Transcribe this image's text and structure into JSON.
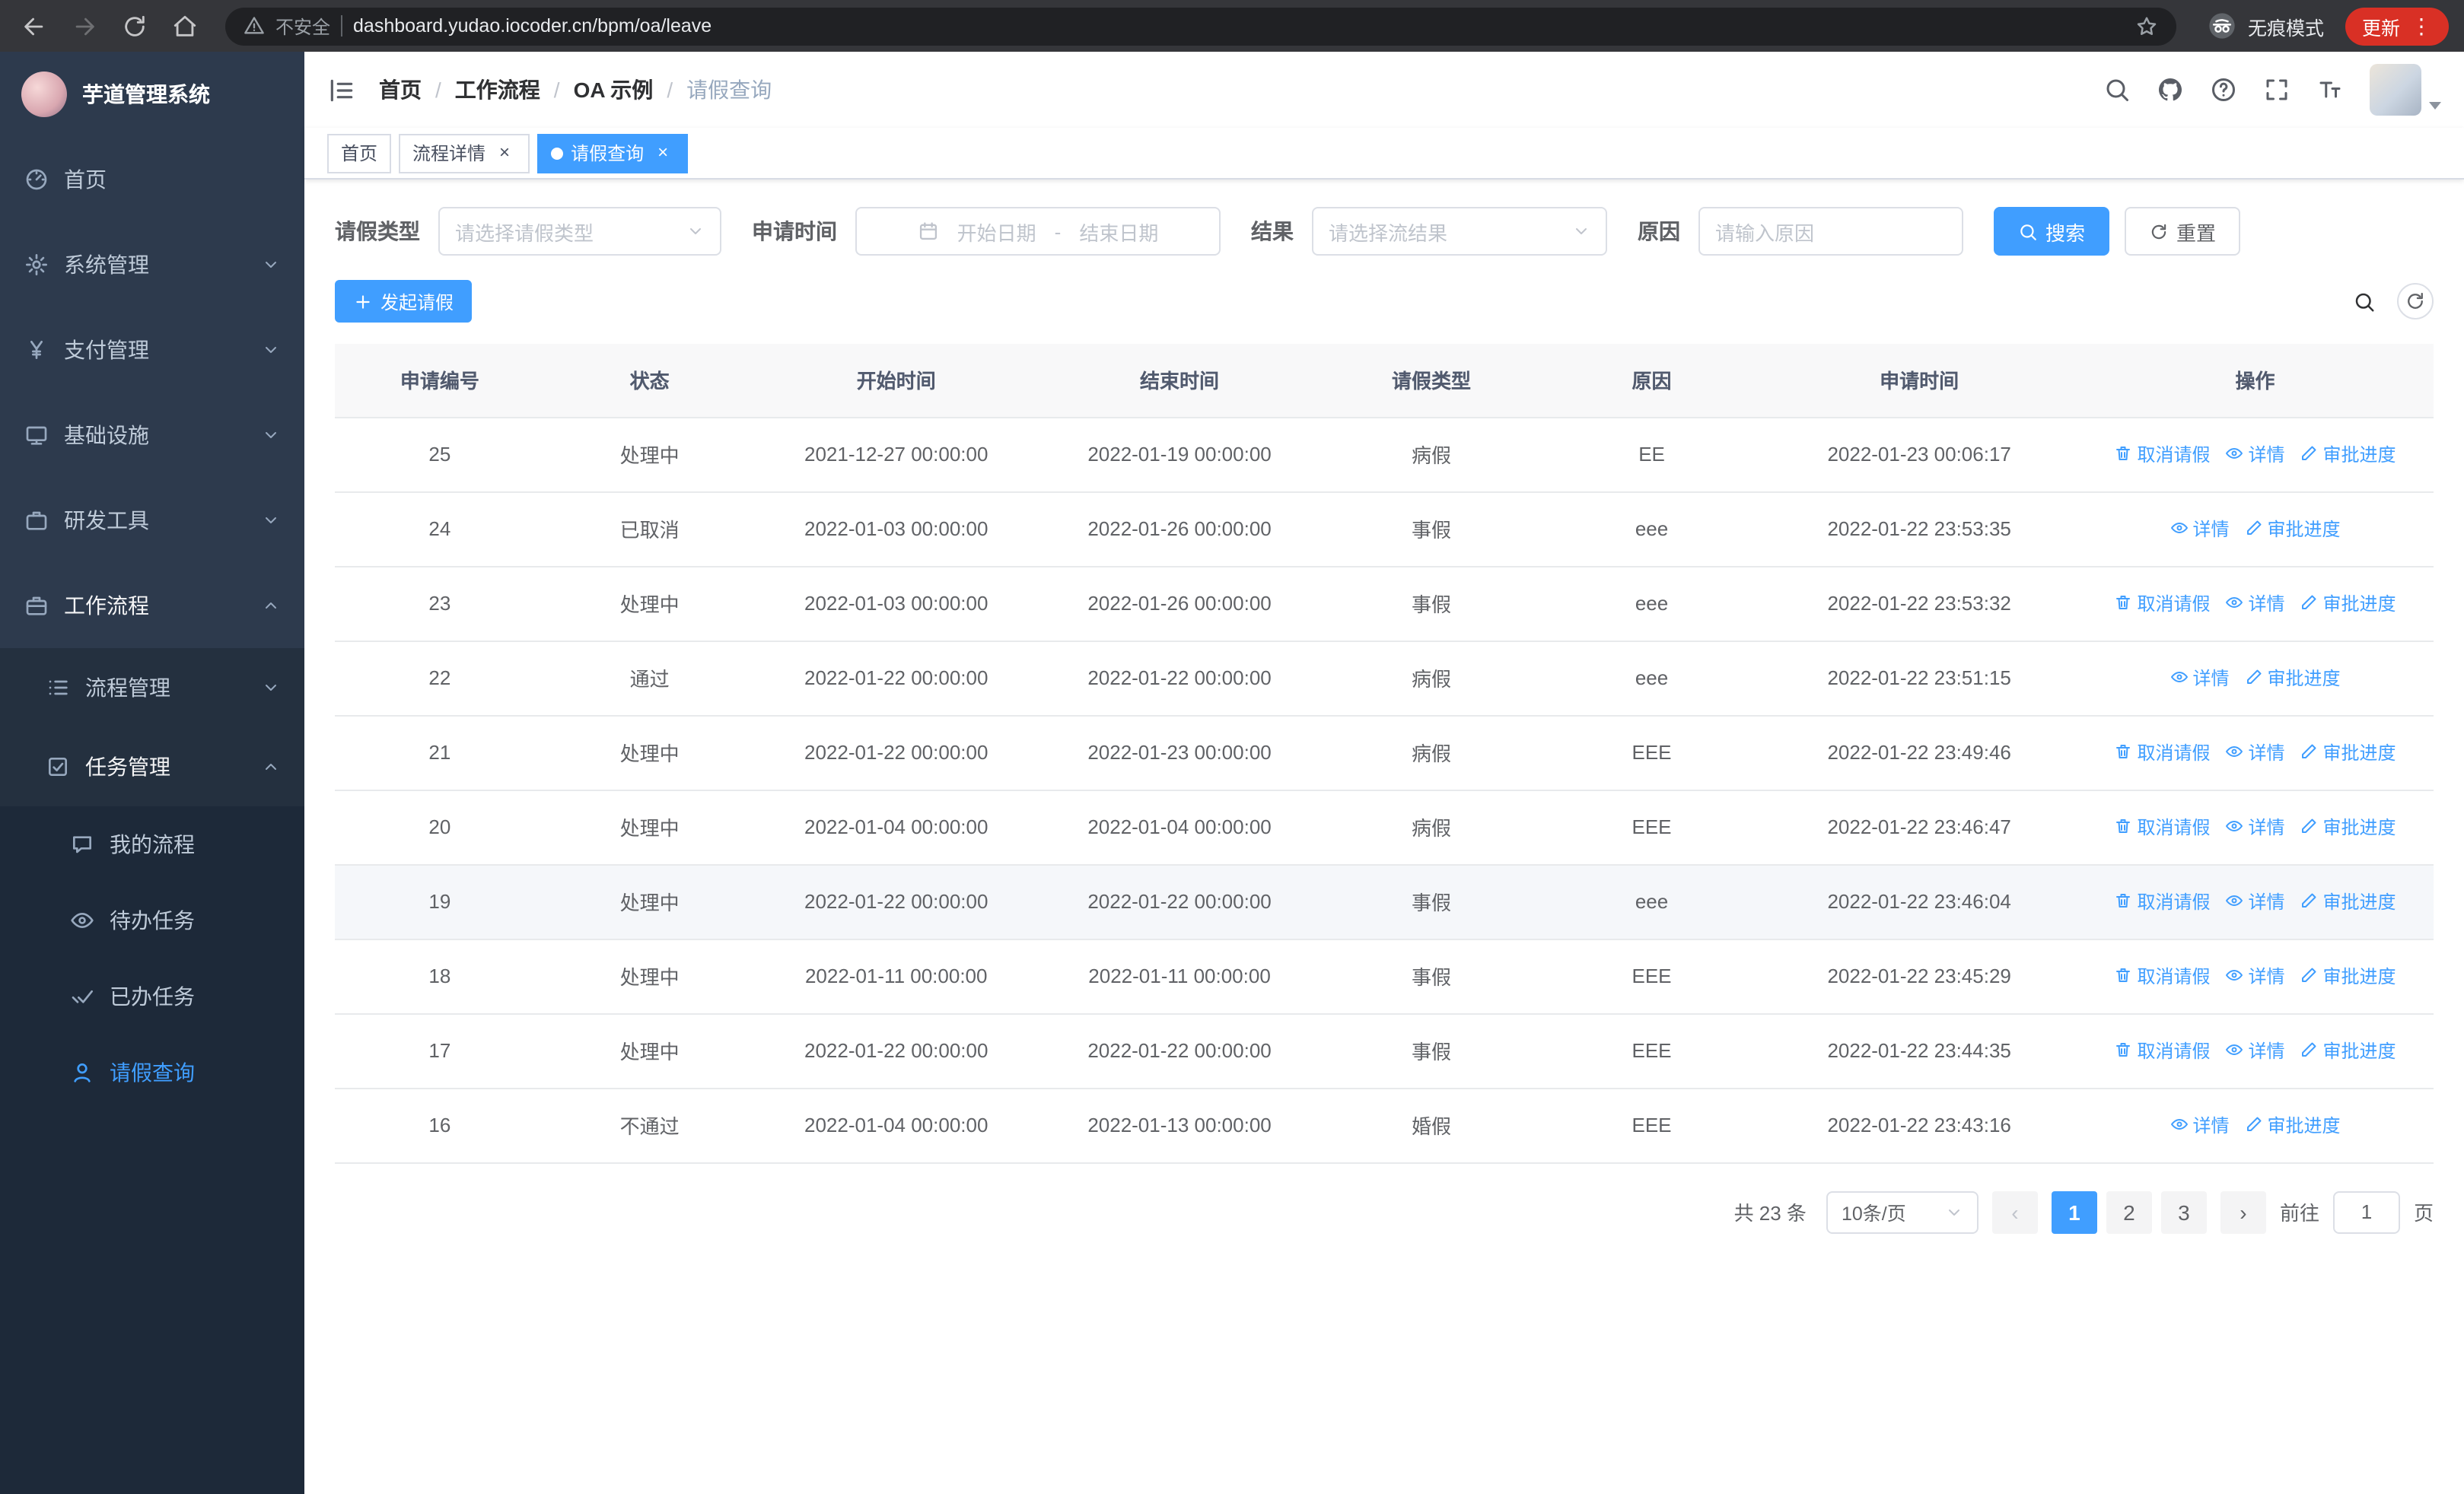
{
  "browser": {
    "security_warning": "不安全",
    "url": "dashboard.yudao.iocoder.cn/bpm/oa/leave",
    "incognito_label": "无痕模式",
    "update_label": "更新"
  },
  "icons": {
    "prev": "‹",
    "next": "›",
    "menu_dots": "⋮",
    "close": "×",
    "breadcrumb_sep": "/"
  },
  "sidebar": {
    "logo_title": "芋道管理系统",
    "items": [
      {
        "name": "home",
        "label": "首页",
        "icon": "dashboard-icon",
        "level": 1
      },
      {
        "name": "system",
        "label": "系统管理",
        "icon": "gear-icon",
        "level": 1,
        "arrow": "down"
      },
      {
        "name": "payment",
        "label": "支付管理",
        "icon": "yen-icon",
        "level": 1,
        "arrow": "down"
      },
      {
        "name": "infrastructure",
        "label": "基础设施",
        "icon": "monitor-icon",
        "level": 1,
        "arrow": "down"
      },
      {
        "name": "dev-tools",
        "label": "研发工具",
        "icon": "briefcase-icon",
        "level": 1,
        "arrow": "down"
      },
      {
        "name": "workflow",
        "label": "工作流程",
        "icon": "workflow-icon",
        "level": 1,
        "arrow": "up",
        "expanded": true
      },
      {
        "name": "process-management",
        "label": "流程管理",
        "icon": "list-icon",
        "level": 2,
        "arrow": "down"
      },
      {
        "name": "task-management",
        "label": "任务管理",
        "icon": "tasks-icon",
        "level": 2,
        "arrow": "up",
        "expanded": true
      },
      {
        "name": "my-process",
        "label": "我的流程",
        "icon": "chat-icon",
        "level": 3
      },
      {
        "name": "todo-tasks",
        "label": "待办任务",
        "icon": "eye-icon",
        "level": 3
      },
      {
        "name": "done-tasks",
        "label": "已办任务",
        "icon": "double-check-icon",
        "level": 3
      },
      {
        "name": "leave-query",
        "label": "请假查询",
        "icon": "user-icon",
        "level": 3,
        "active": true
      }
    ]
  },
  "header": {
    "breadcrumb": [
      "首页",
      "工作流程",
      "OA 示例",
      "请假查询"
    ]
  },
  "tabs": [
    {
      "label": "首页",
      "closable": false,
      "active": false
    },
    {
      "label": "流程详情",
      "closable": true,
      "active": false
    },
    {
      "label": "请假查询",
      "closable": true,
      "active": true
    }
  ],
  "filters": {
    "leave_type_label": "请假类型",
    "leave_type_placeholder": "请选择请假类型",
    "apply_time_label": "申请时间",
    "start_placeholder": "开始日期",
    "range_separator": "-",
    "end_placeholder": "结束日期",
    "result_label": "结果",
    "result_placeholder": "请选择流结果",
    "reason_label": "原因",
    "reason_placeholder": "请输入原因",
    "search_button": "搜索",
    "reset_button": "重置"
  },
  "toolbar": {
    "create_button": "发起请假"
  },
  "table": {
    "columns": [
      "申请编号",
      "状态",
      "开始时间",
      "结束时间",
      "请假类型",
      "原因",
      "申请时间",
      "操作"
    ],
    "action_labels": {
      "cancel": "取消请假",
      "detail": "详情",
      "progress": "审批进度"
    },
    "rows": [
      {
        "id": "25",
        "status": "处理中",
        "start": "2021-12-27 00:00:00",
        "end": "2022-01-19 00:00:00",
        "type": "病假",
        "reason": "EE",
        "apply_time": "2022-01-23 00:06:17",
        "actions": [
          "cancel",
          "detail",
          "progress"
        ]
      },
      {
        "id": "24",
        "status": "已取消",
        "start": "2022-01-03 00:00:00",
        "end": "2022-01-26 00:00:00",
        "type": "事假",
        "reason": "eee",
        "apply_time": "2022-01-22 23:53:35",
        "actions": [
          "detail",
          "progress"
        ]
      },
      {
        "id": "23",
        "status": "处理中",
        "start": "2022-01-03 00:00:00",
        "end": "2022-01-26 00:00:00",
        "type": "事假",
        "reason": "eee",
        "apply_time": "2022-01-22 23:53:32",
        "actions": [
          "cancel",
          "detail",
          "progress"
        ]
      },
      {
        "id": "22",
        "status": "通过",
        "start": "2022-01-22 00:00:00",
        "end": "2022-01-22 00:00:00",
        "type": "病假",
        "reason": "eee",
        "apply_time": "2022-01-22 23:51:15",
        "actions": [
          "detail",
          "progress"
        ]
      },
      {
        "id": "21",
        "status": "处理中",
        "start": "2022-01-22 00:00:00",
        "end": "2022-01-23 00:00:00",
        "type": "病假",
        "reason": "EEE",
        "apply_time": "2022-01-22 23:49:46",
        "actions": [
          "cancel",
          "detail",
          "progress"
        ]
      },
      {
        "id": "20",
        "status": "处理中",
        "start": "2022-01-04 00:00:00",
        "end": "2022-01-04 00:00:00",
        "type": "病假",
        "reason": "EEE",
        "apply_time": "2022-01-22 23:46:47",
        "actions": [
          "cancel",
          "detail",
          "progress"
        ]
      },
      {
        "id": "19",
        "status": "处理中",
        "start": "2022-01-22 00:00:00",
        "end": "2022-01-22 00:00:00",
        "type": "事假",
        "reason": "eee",
        "apply_time": "2022-01-22 23:46:04",
        "actions": [
          "cancel",
          "detail",
          "progress"
        ],
        "highlighted": true
      },
      {
        "id": "18",
        "status": "处理中",
        "start": "2022-01-11 00:00:00",
        "end": "2022-01-11 00:00:00",
        "type": "事假",
        "reason": "EEE",
        "apply_time": "2022-01-22 23:45:29",
        "actions": [
          "cancel",
          "detail",
          "progress"
        ]
      },
      {
        "id": "17",
        "status": "处理中",
        "start": "2022-01-22 00:00:00",
        "end": "2022-01-22 00:00:00",
        "type": "事假",
        "reason": "EEE",
        "apply_time": "2022-01-22 23:44:35",
        "actions": [
          "cancel",
          "detail",
          "progress"
        ]
      },
      {
        "id": "16",
        "status": "不通过",
        "start": "2022-01-04 00:00:00",
        "end": "2022-01-13 00:00:00",
        "type": "婚假",
        "reason": "EEE",
        "apply_time": "2022-01-22 23:43:16",
        "actions": [
          "detail",
          "progress"
        ]
      }
    ]
  },
  "pagination": {
    "total_text": "共 23 条",
    "page_size": "10条/页",
    "pages": [
      "1",
      "2",
      "3"
    ],
    "active_page": "1",
    "goto_label": "前往",
    "goto_value": "1",
    "goto_suffix": "页"
  }
}
